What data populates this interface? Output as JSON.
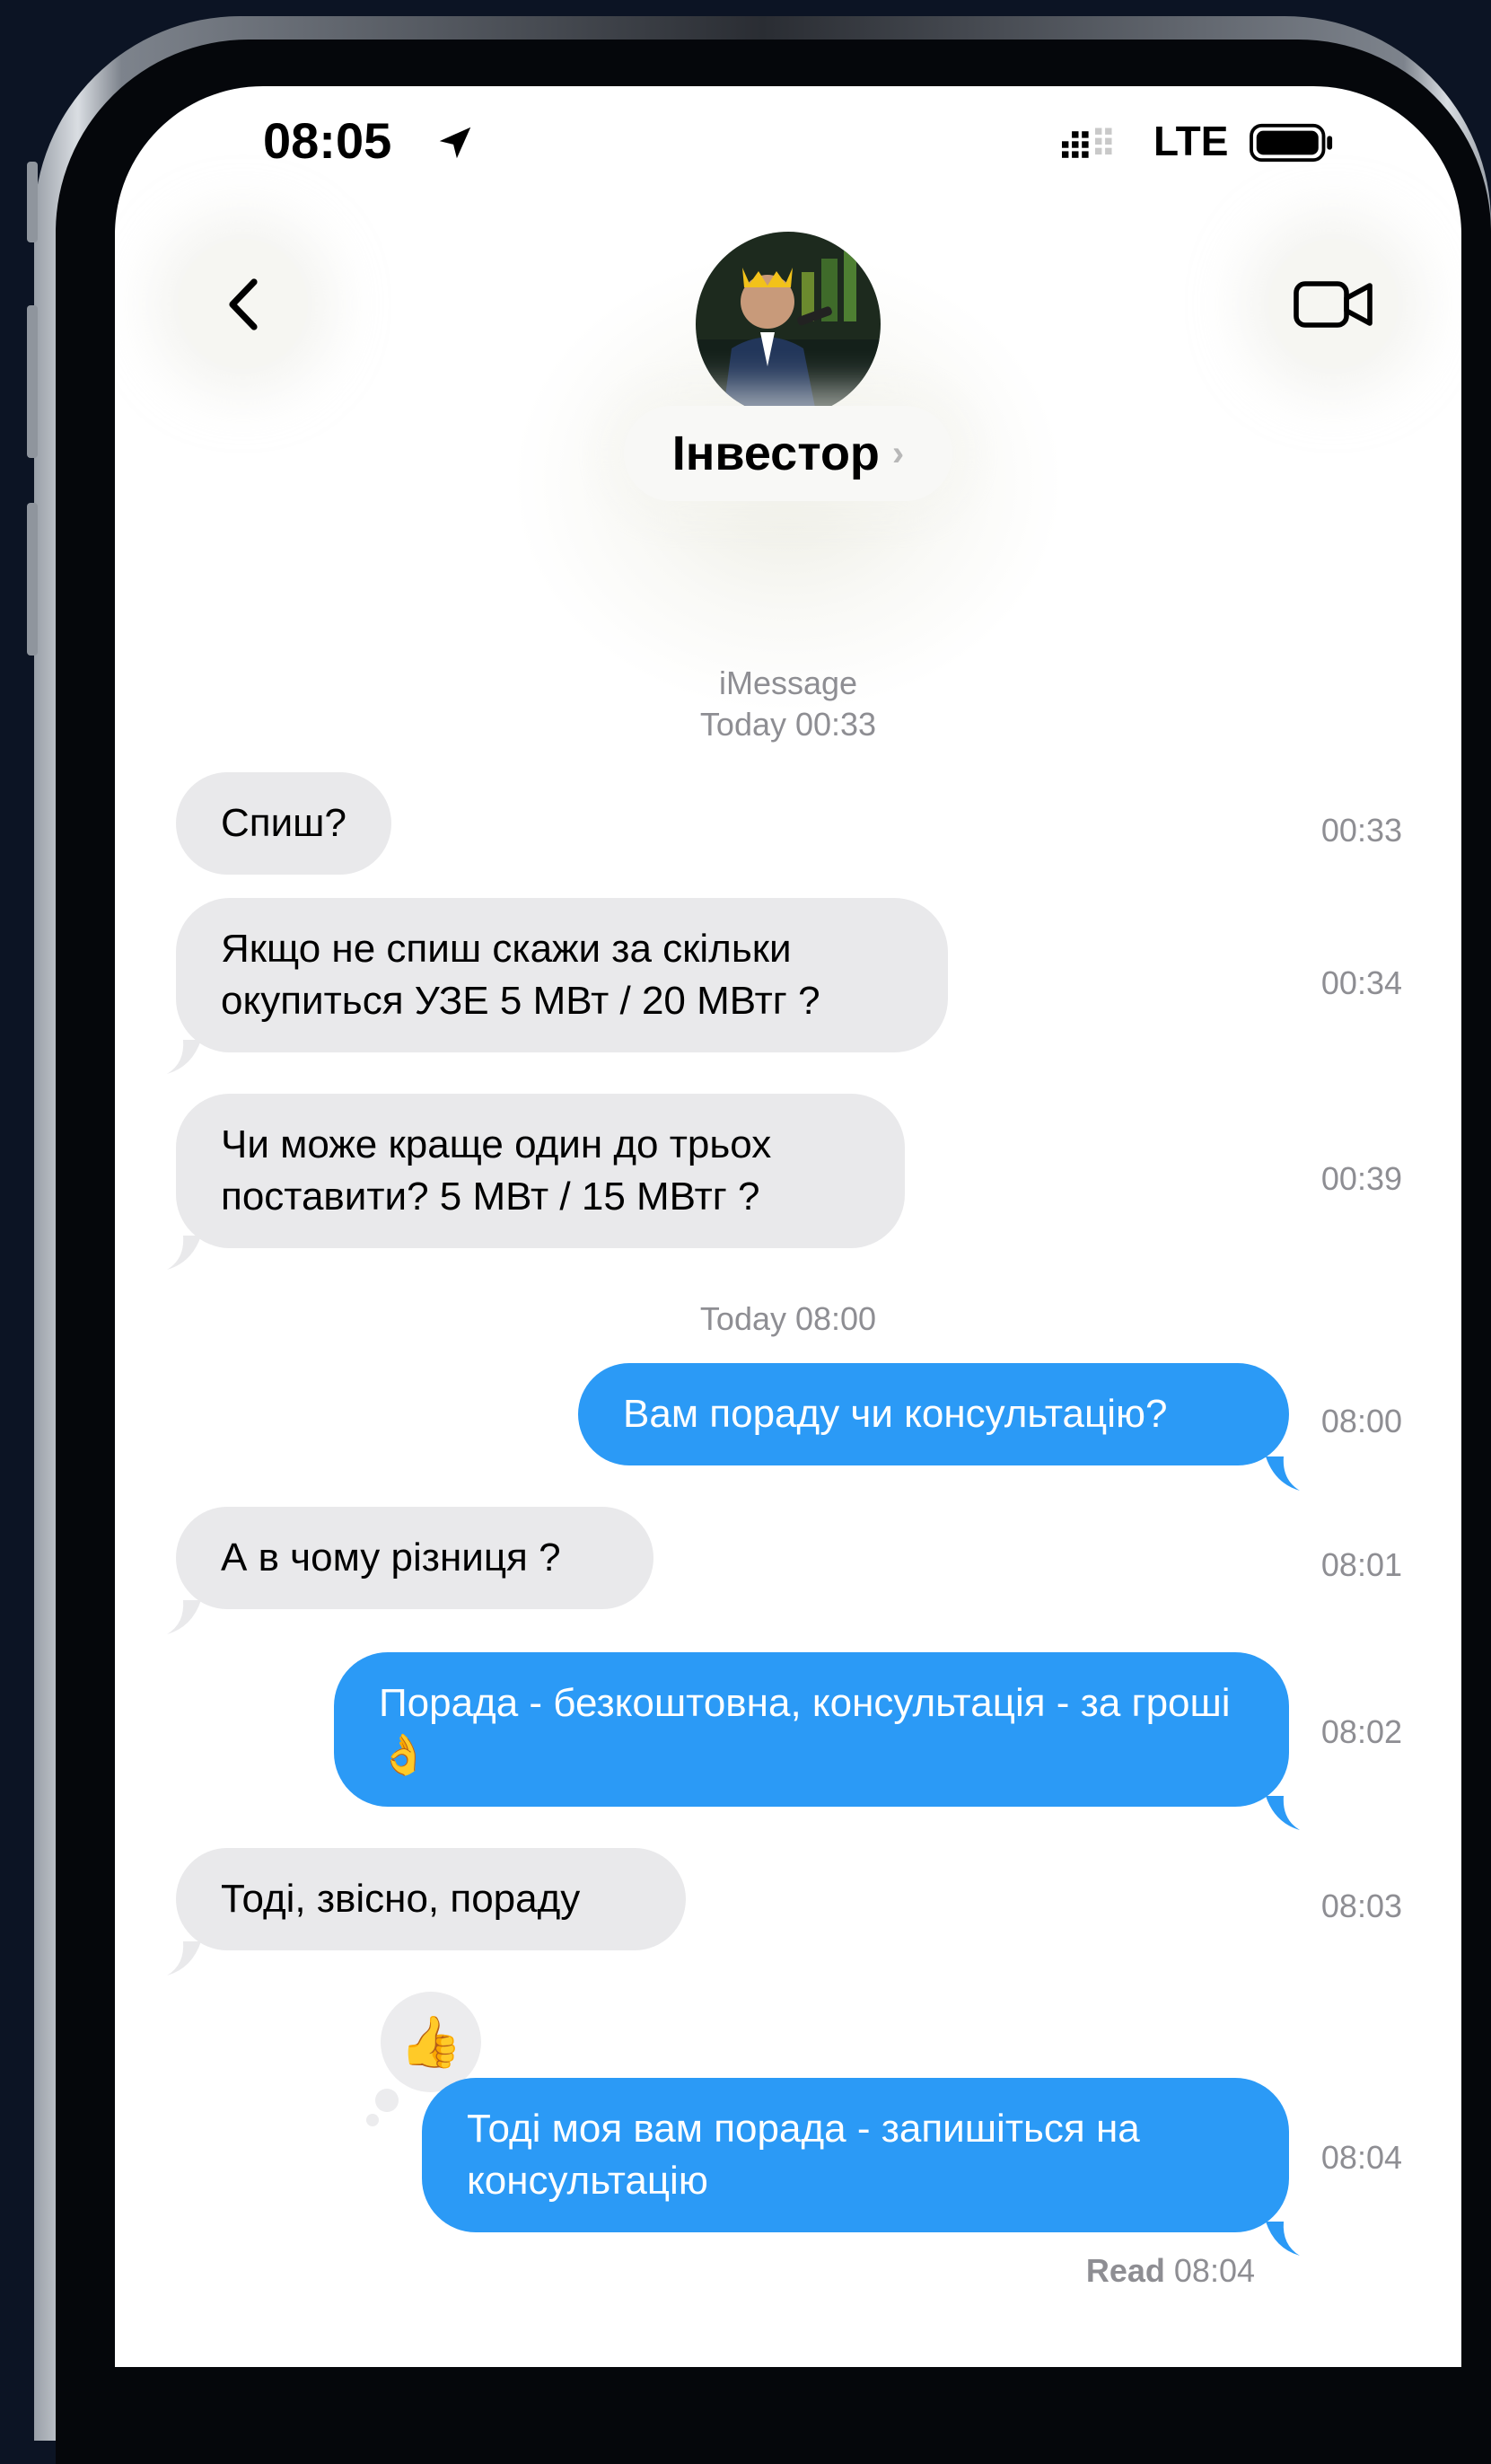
{
  "status_bar": {
    "time": "08:05",
    "network": "LTE",
    "location_icon": "location-arrow-icon",
    "signal_icon": "signal-bars-icon",
    "battery_icon": "battery-icon"
  },
  "header": {
    "contact_name": "Інвестор",
    "chevron": "›",
    "back_icon": "chevron-left-icon",
    "video_icon": "video-camera-icon",
    "avatar_icon": "contact-avatar"
  },
  "conversation": {
    "service": "iMessage",
    "first_day": "Today 00:33",
    "second_day": "Today 08:00",
    "messages": [
      {
        "direction": "incoming",
        "text": "Спиш?",
        "time": "00:33"
      },
      {
        "direction": "incoming",
        "text": "Якщо не спиш скажи за скільки окупиться УЗЕ 5 МВт / 20 МВтг ?",
        "time": "00:34"
      },
      {
        "direction": "incoming",
        "text": "Чи може краще один до трьох поставити? 5 МВт / 15 МВтг ?",
        "time": "00:39"
      },
      {
        "direction": "outgoing",
        "text": "Вам пораду чи консультацію?",
        "time": "08:00"
      },
      {
        "direction": "incoming",
        "text": "А в чому різниця ?",
        "time": "08:01"
      },
      {
        "direction": "outgoing",
        "text": "Порада - безкоштовна, консультація - за гроші 👌",
        "time": "08:02"
      },
      {
        "direction": "incoming",
        "text": "Тоді, звісно, пораду",
        "time": "08:03"
      },
      {
        "direction": "outgoing",
        "text": "Тоді моя вам порада - запишіться на консультацію",
        "time": "08:04"
      }
    ],
    "reaction": "👍",
    "read_label": "Read",
    "read_time": "08:04"
  },
  "colors": {
    "outgoing_bubble": "#2b9af6",
    "incoming_bubble": "#e9e9eb",
    "meta_text": "#8e8e93"
  }
}
